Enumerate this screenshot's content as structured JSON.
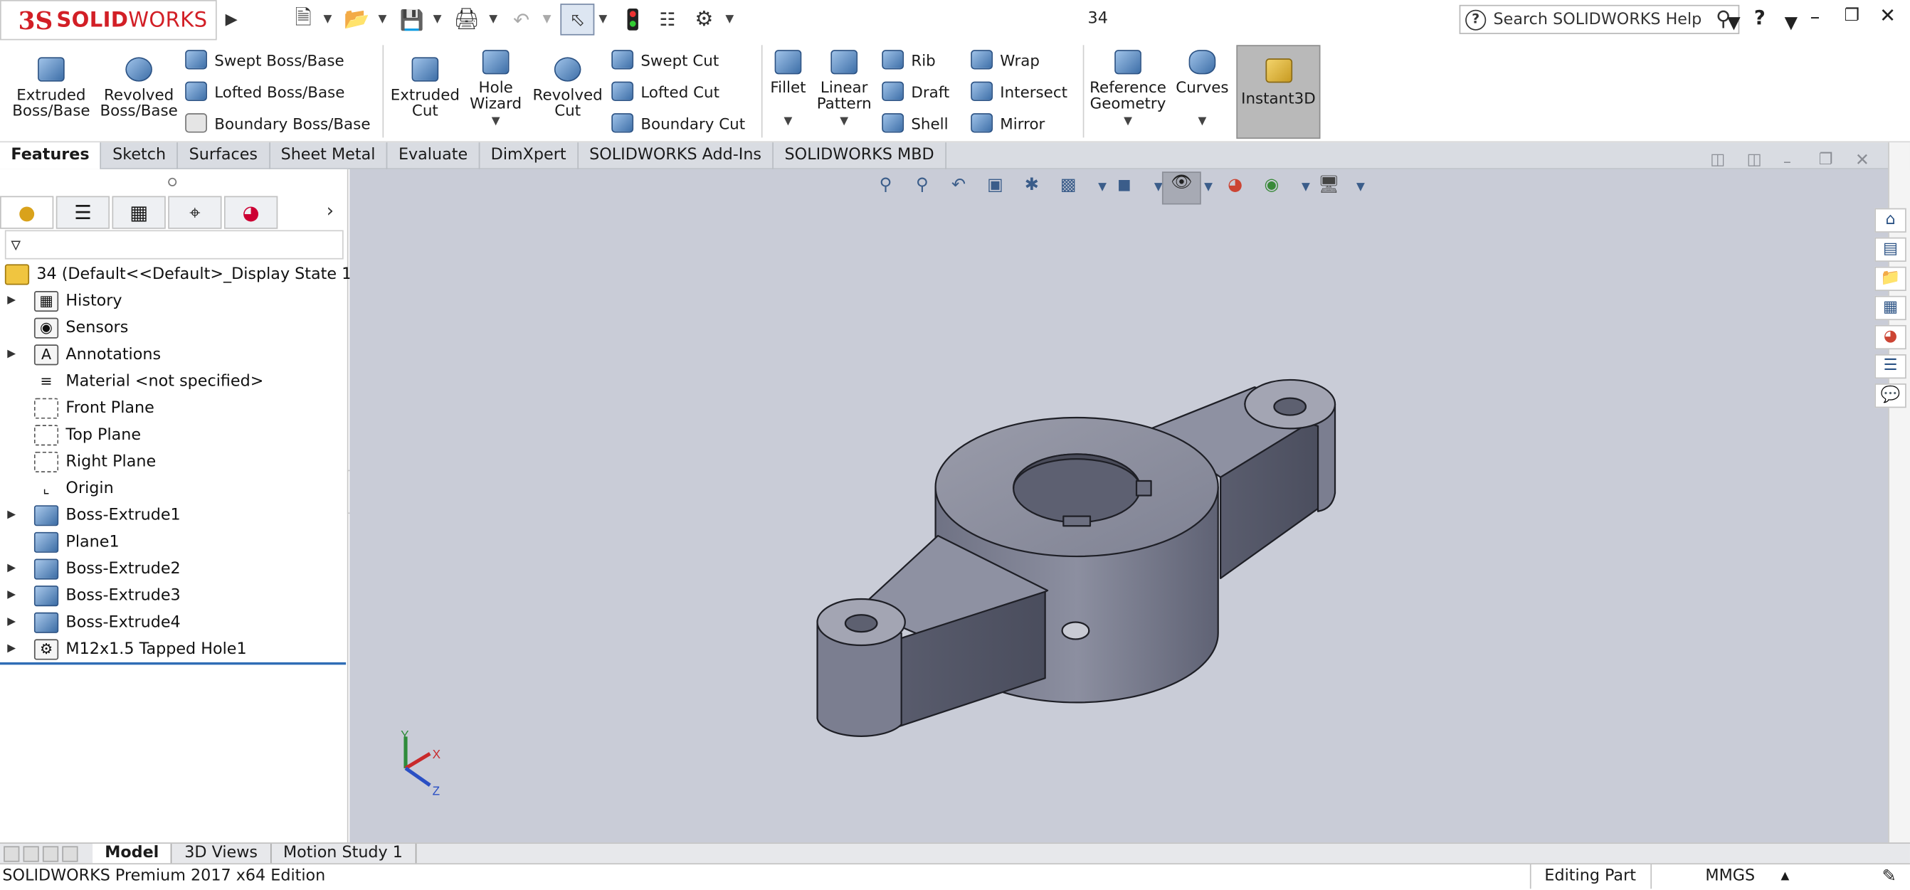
{
  "titlebar": {
    "app_logo_ds": "3S",
    "app_logo_solid": "SOLID",
    "app_logo_works": "WORKS",
    "document_title": "34",
    "search_placeholder": "Search SOLIDWORKS Help",
    "help_label": "?",
    "icons": [
      "new-document-icon",
      "open-folder-icon",
      "save-icon",
      "print-icon",
      "undo-icon",
      "select-arrow-icon",
      "rebuild-traffic-light-icon",
      "file-properties-icon",
      "options-gear-icon"
    ]
  },
  "ribbon": {
    "extruded_boss": [
      "Extruded",
      "Boss/Base"
    ],
    "revolved_boss": [
      "Revolved",
      "Boss/Base"
    ],
    "swept_boss": "Swept Boss/Base",
    "lofted_boss": "Lofted Boss/Base",
    "boundary_boss": "Boundary Boss/Base",
    "extruded_cut": [
      "Extruded",
      "Cut"
    ],
    "hole_wizard": [
      "Hole",
      "Wizard"
    ],
    "revolved_cut": [
      "Revolved",
      "Cut"
    ],
    "swept_cut": "Swept Cut",
    "lofted_cut": "Lofted Cut",
    "boundary_cut": "Boundary Cut",
    "fillet": "Fillet",
    "linear_pattern": [
      "Linear",
      "Pattern"
    ],
    "rib": "Rib",
    "draft": "Draft",
    "shell": "Shell",
    "wrap": "Wrap",
    "intersect": "Intersect",
    "mirror": "Mirror",
    "reference_geometry": [
      "Reference",
      "Geometry"
    ],
    "curves": "Curves",
    "instant3d": "Instant3D"
  },
  "command_tabs": [
    "Features",
    "Sketch",
    "Surfaces",
    "Sheet Metal",
    "Evaluate",
    "DimXpert",
    "SOLIDWORKS Add-Ins",
    "SOLIDWORKS MBD"
  ],
  "feature_tree": {
    "root": "34  (Default<<Default>_Display State 1>)",
    "items": [
      {
        "label": "History",
        "expandable": true,
        "icon": "history-folder-icon"
      },
      {
        "label": "Sensors",
        "expandable": false,
        "icon": "sensors-icon"
      },
      {
        "label": "Annotations",
        "expandable": true,
        "icon": "annotations-icon"
      },
      {
        "label": "Material <not specified>",
        "expandable": false,
        "icon": "material-icon"
      },
      {
        "label": "Front Plane",
        "expandable": false,
        "icon": "plane-icon"
      },
      {
        "label": "Top Plane",
        "expandable": false,
        "icon": "plane-icon"
      },
      {
        "label": "Right Plane",
        "expandable": false,
        "icon": "plane-icon"
      },
      {
        "label": "Origin",
        "expandable": false,
        "icon": "origin-icon"
      },
      {
        "label": "Boss-Extrude1",
        "expandable": true,
        "icon": "extrude-feature-icon"
      },
      {
        "label": "Plane1",
        "expandable": false,
        "icon": "plane-feature-icon"
      },
      {
        "label": "Boss-Extrude2",
        "expandable": true,
        "icon": "extrude-feature-icon"
      },
      {
        "label": "Boss-Extrude3",
        "expandable": true,
        "icon": "extrude-feature-icon"
      },
      {
        "label": "Boss-Extrude4",
        "expandable": true,
        "icon": "extrude-feature-icon"
      },
      {
        "label": "M12x1.5 Tapped Hole1",
        "expandable": true,
        "icon": "hole-feature-icon"
      }
    ]
  },
  "bottom_tabs": [
    "Model",
    "3D Views",
    "Motion Study 1"
  ],
  "status_bar": {
    "edition": "SOLIDWORKS Premium 2017 x64 Edition",
    "mode": "Editing Part",
    "units": "MMGS"
  },
  "triad": {
    "x": "X",
    "y": "Y",
    "z": "Z"
  },
  "colors": {
    "brand_red": "#d21f26",
    "viewport_bg": "#c9ccd7",
    "part_gray": "#8c8f9f",
    "selection_blue": "#2f6db5"
  }
}
